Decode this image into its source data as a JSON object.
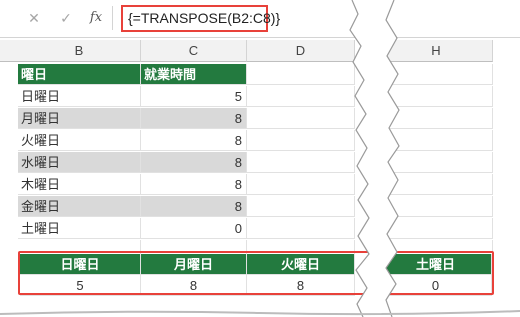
{
  "formula_bar": {
    "cancel_icon": "✕",
    "enter_icon": "✓",
    "function_icon": "fx",
    "formula": "{=TRANSPOSE(B2:C8)}"
  },
  "columns": [
    "B",
    "C",
    "D",
    "H"
  ],
  "source_table": {
    "headers": [
      "曜日",
      "就業時間"
    ],
    "rows": [
      {
        "day": "日曜日",
        "hours": "5"
      },
      {
        "day": "月曜日",
        "hours": "8"
      },
      {
        "day": "火曜日",
        "hours": "8"
      },
      {
        "day": "水曜日",
        "hours": "8"
      },
      {
        "day": "木曜日",
        "hours": "8"
      },
      {
        "day": "金曜日",
        "hours": "8"
      },
      {
        "day": "土曜日",
        "hours": "0"
      }
    ]
  },
  "transposed_table": {
    "headers": [
      "日曜日",
      "月曜日",
      "火曜日",
      "土曜日"
    ],
    "values": [
      "5",
      "8",
      "8",
      "0"
    ]
  },
  "colors": {
    "header_green": "#237a3f",
    "band_gray": "#d9d9d9",
    "highlight_red": "#e8413a"
  }
}
